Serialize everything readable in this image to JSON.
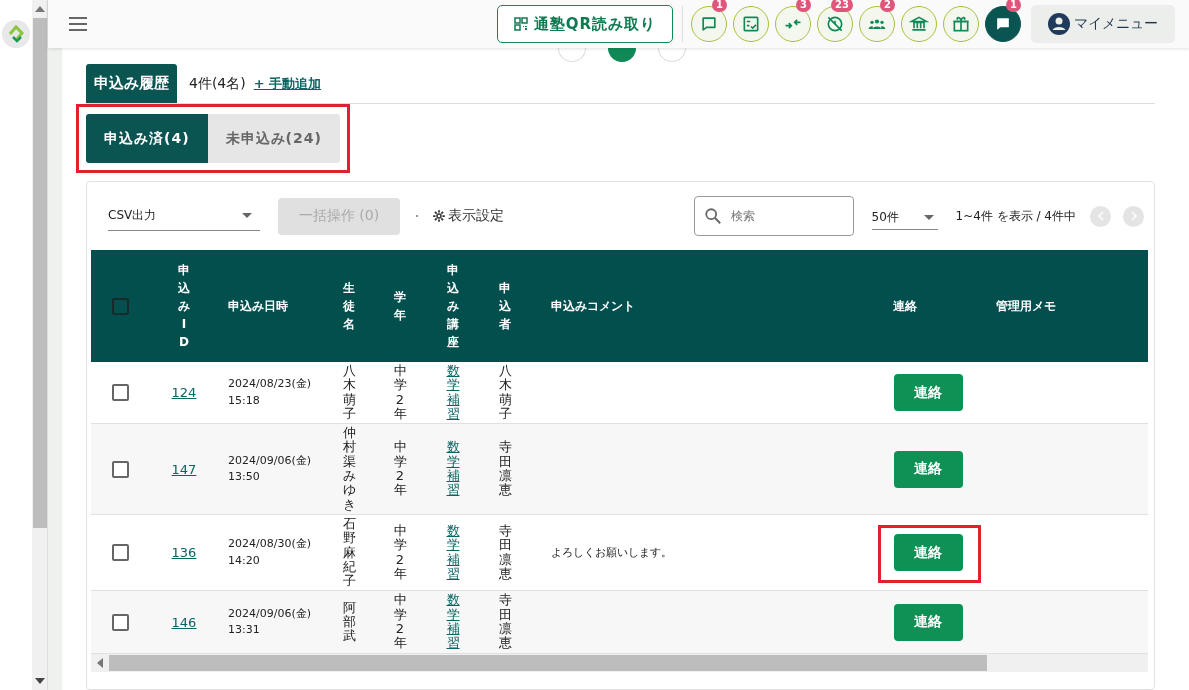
{
  "header": {
    "qr_button": "通塾QR読み取り",
    "nav_icons": [
      {
        "kind": "chat",
        "badge": "1"
      },
      {
        "kind": "checklist"
      },
      {
        "kind": "merge",
        "badge": "3"
      },
      {
        "kind": "clock-off",
        "badge": "23"
      },
      {
        "kind": "group",
        "badge": "2"
      },
      {
        "kind": "bank"
      },
      {
        "kind": "gift"
      },
      {
        "kind": "message",
        "badge": "1"
      }
    ],
    "my_menu": "マイメニュー"
  },
  "steps": [
    {
      "selected": false
    },
    {
      "selected": true
    },
    {
      "selected": false
    }
  ],
  "section": {
    "title": "申込み履歴",
    "count": "4件(4名)",
    "add_link": "+ 手動追加"
  },
  "tabs": [
    {
      "label": "申込み済(4)",
      "selected": true
    },
    {
      "label": "未申込み(24)",
      "selected": false
    }
  ],
  "toolbar": {
    "csv": "CSV出力",
    "bulk": "一括操作 (0)",
    "bulk_disabled": true,
    "settings": "表示設定",
    "search": {
      "placeholder": "検索"
    },
    "per_page": "50件",
    "range": "1~4件 を表示 / 4件中"
  },
  "table": {
    "header_checked": false,
    "columns": [
      "申込みID",
      "申込み日時",
      "生徒名",
      "学年",
      "申込み講座",
      "申込者",
      "申込みコメント",
      "連絡",
      "管理用メモ"
    ],
    "rows": [
      {
        "checked": false,
        "id": "124",
        "date": "2024/08/23(金)",
        "time": "15:18",
        "student": "八木萌子",
        "grade": "中学2年",
        "course": "数学補習",
        "applicant": "八木萌子",
        "comment": "",
        "contact": "連絡",
        "highlight": false
      },
      {
        "checked": false,
        "id": "147",
        "date": "2024/09/06(金)",
        "time": "13:50",
        "student": "仲村渠みゆき",
        "grade": "中学2年",
        "course": "数学補習",
        "applicant": "寺田凛恵",
        "comment": "",
        "contact": "連絡",
        "highlight": false
      },
      {
        "checked": false,
        "id": "136",
        "date": "2024/08/30(金)",
        "time": "14:20",
        "student": "石野麻紀子",
        "grade": "中学2年",
        "course": "数学補習",
        "applicant": "寺田凛恵",
        "comment": "よろしくお願いします。",
        "contact": "連絡",
        "highlight": true
      },
      {
        "checked": false,
        "id": "146",
        "date": "2024/09/06(金)",
        "time": "13:31",
        "student": "阿部武",
        "grade": "中学2年",
        "course": "数学補習",
        "applicant": "寺田凛恵",
        "comment": "",
        "contact": "連絡",
        "highlight": false
      }
    ]
  },
  "tabs_highlight": true
}
